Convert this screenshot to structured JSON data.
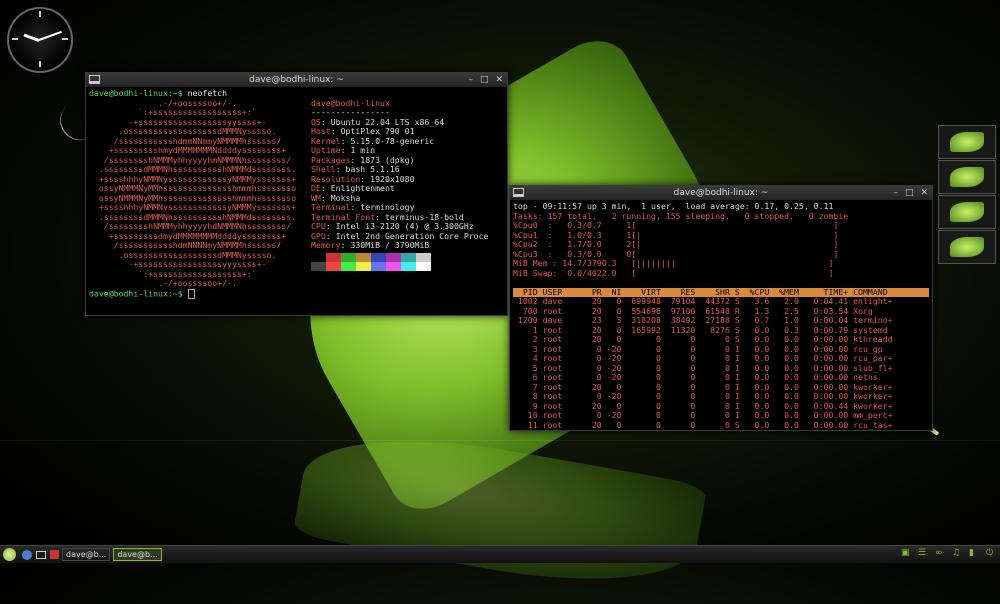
{
  "desktop": {
    "wallpaper": "green-leaf",
    "accent": "#7fbf2a"
  },
  "window1": {
    "title": "dave@bodhi-linux: ~",
    "prompt1": "dave@bodhi-linux:~$",
    "cmd1": " neofetch",
    "prompt2": "dave@bodhi-linux:~$",
    "logo": "              .-/+oossssoo+/-.\n          `:+ssssssssssssssssss+:`\n        -+ssssssssssssssssssyyssss+-\n      .ossssssssssssssssssdMMMNysssso.\n     /ssssssssssshdmmNNmmyNMMMMhssssss/\n    +ssssssssshmydMMMMMMMNddddyssssssss+\n   /sssssssshNMMMyhhyyyyhmNMMMNhssssssss/\n  .ssssssssdMMMNhsssssssssshNMMMdssssssss.\n  +sssshhhyNMMNyssssssssssssyNMMMysssssss+\n  ossyNMMMNyMMhsssssssssssssshmmmhssssssso\n  ossyNMMMNyMMhsssssssssssssshmmmhssssssso\n  +sssshhhyNMMNyssssssssssssyNMMMysssssss+\n  .ssssssssdMMMNhsssssssssshNMMMdssssssss.\n   /sssssssshNMMMyhhyyyyhdNMMMNhssssssss/\n    +sssssssssdmydMMMMMMMMddddyssssssss+\n     /ssssssssssshdmNNNNmyNMMMMhssssss/\n      .ossssssssssssssssssdMMMNysssso.\n        -+sssssssssssssssssyyyssss+-\n          `:+ssssssssssssssssss+:`\n              .-/+oossssoo+/-.",
    "user_host": "dave@bodhi-linux",
    "separator": "----------------",
    "info": [
      {
        "key": "OS",
        "value": "Ubuntu 22.04 LTS x86_64"
      },
      {
        "key": "Host",
        "value": "OptiPlex 790 01"
      },
      {
        "key": "Kernel",
        "value": "5.15.0-78-generic"
      },
      {
        "key": "Uptime",
        "value": "1 min"
      },
      {
        "key": "Packages",
        "value": "1873 (dpkg)"
      },
      {
        "key": "Shell",
        "value": "bash 5.1.16"
      },
      {
        "key": "Resolution",
        "value": "1920x1080"
      },
      {
        "key": "DE",
        "value": "Enlightenment"
      },
      {
        "key": "WM",
        "value": "Moksha"
      },
      {
        "key": "Terminal",
        "value": "terminology"
      },
      {
        "key": "Terminal Font",
        "value": "terminus-18-bold"
      },
      {
        "key": "CPU",
        "value": "Intel i3-2120 (4) @ 3.300GHz"
      },
      {
        "key": "GPU",
        "value": "Intel 2nd Generation Core Proce"
      },
      {
        "key": "Memory",
        "value": "330MiB / 3790MiB"
      }
    ],
    "palette_top": [
      "#000000",
      "#cc3333",
      "#33aa33",
      "#bb8833",
      "#3344bb",
      "#aa33aa",
      "#33aaaa",
      "#cccccc"
    ],
    "palette_bottom": [
      "#444444",
      "#ee4444",
      "#44ee44",
      "#eeee44",
      "#6677ee",
      "#ee55ee",
      "#44eeee",
      "#ffffff"
    ]
  },
  "window2": {
    "title": "dave@bodhi-linux: ~",
    "top_line": "top - 09:11:57 up 3 min,  1 user,  load average: 0.17, 0.25, 0.11",
    "tasks_line": "Tasks: 157 total,   2 running, 155 sleeping,   0 stopped,   0 zombie",
    "cpu_lines": [
      "%Cpu0  :   0.3/0.7     1[                                        ]",
      "%Cpu1  :   1.0/0.3     1[|                                       ]",
      "%Cpu2  :   1.7/0.0     2[|                                       ]",
      "%Cpu3  :   0.3/0.0     0[                                        ]"
    ],
    "mem_line": "MiB Mem : 14.7/3790.3   [||||||||                               ]",
    "swap_line": "MiB Swap:  0.0/4022.0   [                                       ]",
    "proc_header": "  PID USER      PR  NI    VIRT    RES    SHR S  %CPU  %MEM     TIME+ COMMAND",
    "processes": [
      " 1002 dave      20   0  699948  79104  44372 S   3.6   2.0   0:04.41 enlight+",
      "  700 root      20   0  554696  97100  61548 R   1.3   2.5   0:03.54 Xorg",
      " 1200 dave      23   3  318208  38492  27188 S   0.7   1.0   0:00.04 termino+",
      "    1 root      20   0  165992  11320   8276 S   0.0   0.3   0:00.79 systemd",
      "    2 root      20   0       0      0      0 S   0.0   0.0   0:00.00 kthreadd",
      "    3 root       0 -20       0      0      0 I   0.0   0.0   0:00.00 rcu_gp",
      "    4 root       0 -20       0      0      0 I   0.0   0.0   0:00.00 rcu_par+",
      "    5 root       0 -20       0      0      0 I   0.0   0.0   0:00.00 slub_fl+",
      "    6 root       0 -20       0      0      0 I   0.0   0.0   0:00.00 netns",
      "    7 root      20   0       0      0      0 I   0.0   0.0   0:00.00 kworker+",
      "    8 root       0 -20       0      0      0 I   0.0   0.0   0:00.00 kworker+",
      "    9 root      20   0       0      0      0 I   0.0   0.0   0:00.44 kworker+",
      "   10 root       0 -20       0      0      0 I   0.0   0.0   0:00.00 mm_perc+",
      "   11 root      20   0       0      0      0 S   0.0   0.0   0:00.00 rcu_tas+"
    ]
  },
  "taskbar": {
    "items": [
      {
        "label": "dave@b...",
        "active": false
      },
      {
        "label": "dave@b...",
        "active": true
      }
    ]
  }
}
